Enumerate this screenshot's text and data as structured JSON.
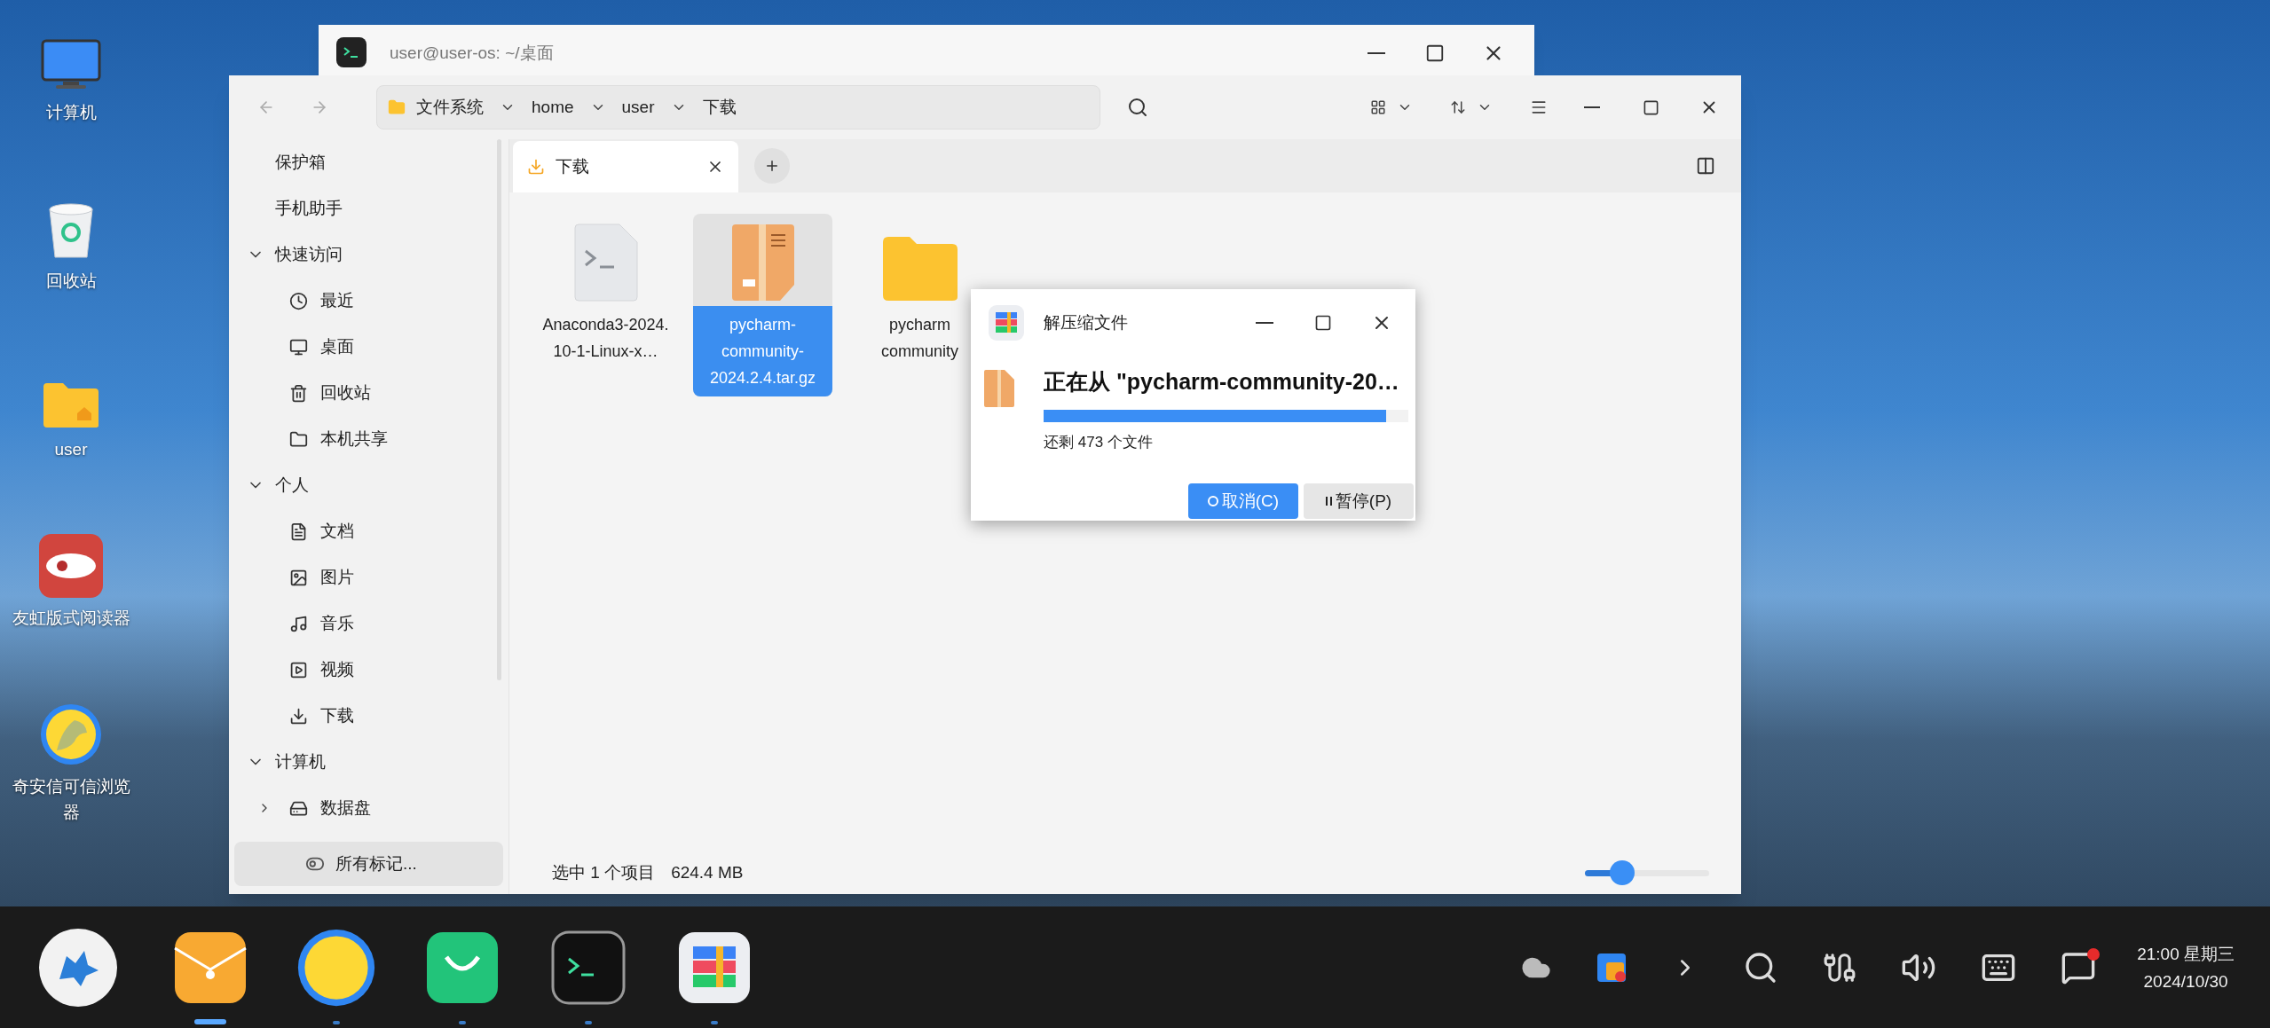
{
  "desktop_icons": [
    {
      "label": "计算机"
    },
    {
      "label": "回收站"
    },
    {
      "label": "user"
    },
    {
      "label": "友虹版式阅读器"
    },
    {
      "label": "奇安信可信浏览器"
    }
  ],
  "terminal_window": {
    "title": "user@user-os: ~/桌面"
  },
  "file_manager": {
    "breadcrumb": [
      {
        "label": "文件系统"
      },
      {
        "label": "home"
      },
      {
        "label": "user"
      },
      {
        "label": "下载"
      }
    ],
    "tabs": [
      {
        "label": "下载",
        "selected": true
      }
    ],
    "sidebar": {
      "items": [
        {
          "label": "保护箱"
        },
        {
          "label": "手机助手"
        },
        {
          "label": "快速访问",
          "expanded": true,
          "children": [
            {
              "label": "最近"
            },
            {
              "label": "桌面"
            },
            {
              "label": "回收站"
            },
            {
              "label": "本机共享"
            }
          ]
        },
        {
          "label": "个人",
          "expanded": true,
          "children": [
            {
              "label": "文档"
            },
            {
              "label": "图片"
            },
            {
              "label": "音乐"
            },
            {
              "label": "视频"
            },
            {
              "label": "下载"
            }
          ]
        },
        {
          "label": "计算机",
          "expanded": true,
          "children": [
            {
              "label": "数据盘",
              "expanded": false
            }
          ]
        }
      ],
      "tags_button": "所有标记..."
    },
    "files": [
      {
        "kind": "script",
        "name": "Anaconda3-2024.10-1-Linux-x…",
        "selected": false
      },
      {
        "kind": "archive",
        "name": "pycharm-community-2024.2.4.tar.gz",
        "selected": true
      },
      {
        "kind": "folder",
        "name": "pycharm community",
        "selected": false
      }
    ],
    "status": {
      "selection": "选中 1 个项目",
      "size": "624.4 MB"
    },
    "zoom_slider": {
      "level": 0.3
    }
  },
  "extract_dialog": {
    "title": "解压缩文件",
    "heading": "正在从 \"pycharm-community-20…",
    "progress": {
      "level": 0.94
    },
    "remaining": "还剩 473 个文件",
    "buttons": [
      {
        "label": "取消(C)",
        "primary": true
      },
      {
        "label": "暂停(P)",
        "primary": false
      }
    ]
  },
  "taskbar": {
    "apps": [
      {
        "focused": true
      },
      {
        "focused": false
      },
      {
        "focused": false
      },
      {
        "focused": false
      },
      {
        "focused": false
      }
    ],
    "notifications": {
      "unread": true
    },
    "clock": {
      "time": "21:00 星期三",
      "date": "2024/10/30"
    }
  }
}
